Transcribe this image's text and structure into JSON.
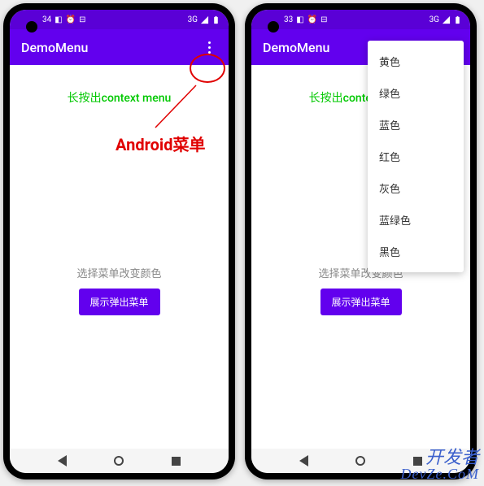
{
  "status": {
    "time_left": "34",
    "time_right": "33",
    "network": "3G",
    "icons": [
      "debug",
      "alarm",
      "battery"
    ]
  },
  "app": {
    "title": "DemoMenu"
  },
  "content": {
    "context_label": "长按出context menu",
    "select_label": "选择菜单改变颜色",
    "popup_button": "展示弹出菜单"
  },
  "annotation": {
    "label": "Android菜单"
  },
  "menu": {
    "items": [
      "黄色",
      "绿色",
      "蓝色",
      "红色",
      "灰色",
      "蓝绿色",
      "黑色"
    ]
  },
  "watermark": {
    "line1": "开发者",
    "line2": "DevZe.CoM"
  }
}
